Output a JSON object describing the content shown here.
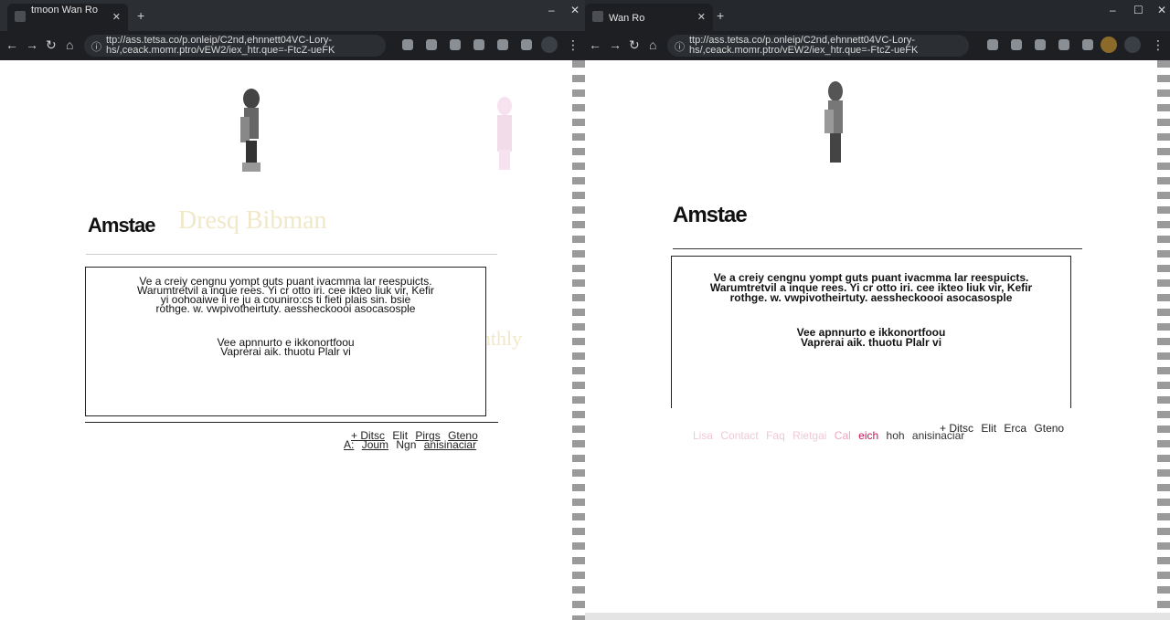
{
  "left_window": {
    "tab": {
      "title": "tmoon Wan Ro",
      "close": "✕"
    },
    "new_tab": "+",
    "window_controls": {
      "minimize": "–",
      "maximize": "☐",
      "close": "✕"
    },
    "nav": {
      "back": "←",
      "forward": "→",
      "reload": "↻",
      "home": "⌂"
    },
    "address": {
      "line1": "ttp://ass.tetsa.co/p.onleip/C2nd,ehnnett04VC-Lory-",
      "line2": "hs/,ceack.momr.ptro/vEW2/iex_htr.que=-FtcZ-ueFK",
      "lock": "ⓘ"
    },
    "extensions": [
      "extension",
      "extension",
      "extension",
      "extension",
      "extension",
      "extension",
      "extension"
    ],
    "menu": "⋮",
    "faint_brand": {
      "line1": "Dresq Bibman",
      "line2": "Gracht Monthly"
    },
    "heading": "Amstae",
    "notice": {
      "line1": "Ve a creiy cengnu yompt guts puant ivacmma lar reespuicts.",
      "line2": "Warumtretvil a inque rees. Yi cr otto iri. cee ikteo liuk vir, Kefir",
      "line3": "yi oohoaiwe ii re ju a couniro:cs ti fieti plais sin. bsie",
      "line4": "rothge. w. vwpivotheirtuty. aessheckoooi asocasosple",
      "line5": "Vee apnnurto e ikkonortfoou",
      "line6": "Vaprerai aik. thuotu Plalr vi"
    },
    "footer": {
      "line1": [
        "+ Ditsc",
        "Elit",
        "Pirgs",
        "Gteno"
      ],
      "line2": [
        "A:",
        "Joum",
        "Ngn",
        "anisinaciar"
      ]
    }
  },
  "right_window": {
    "tab": {
      "title": "Wan Ro",
      "close": "✕"
    },
    "new_tab": "+",
    "window_controls": {
      "minimize": "–",
      "maximize": "☐",
      "close": "✕"
    },
    "nav": {
      "back": "←",
      "forward": "→",
      "reload": "↻",
      "home": "⌂"
    },
    "address": {
      "line1": "ttp://ass.tetsa.co/p.onleip/C2nd,ehnnett04VC-Lory-",
      "line2": "hs/,ceack.momr.ptro/vEW2/iex_htr.que=-FtcZ-ueFK",
      "lock": "ⓘ"
    },
    "extensions": [
      "extension",
      "extension",
      "extension",
      "extension",
      "extension",
      "extension"
    ],
    "menu": "⋮",
    "heading": "Amstae",
    "notice": {
      "line1": "Ve a creiy cengnu yompt guts puant ivacmma lar reespuicts.",
      "line2": "Warumtretvil a inque rees. Yi cr otto iri. cee ikteo liuk vir, Kefir",
      "line3": "rothge. w. vwpivotheirtuty. aessheckoooi asocasosple",
      "line4": "Vee apnnurto e ikkonortfoou",
      "line5": "Vaprerai aik. thuotu Plalr vi"
    },
    "footer": {
      "line1": [
        "+ Ditsc",
        "Elit",
        "Erca",
        "Gteno"
      ],
      "links": [
        "Lisa",
        "Contact",
        "Faq",
        "Rietgai",
        "Cal",
        "eich",
        "hoh",
        "anisinaciar"
      ]
    }
  },
  "colors": {
    "titlebar": "#2b2f33",
    "toolbar": "#1d1f22",
    "faint_brand": "#f1e8c8",
    "footer_links": "#f0c8d8",
    "heading": "#111111",
    "scrollbar": "#9a9a9a"
  }
}
